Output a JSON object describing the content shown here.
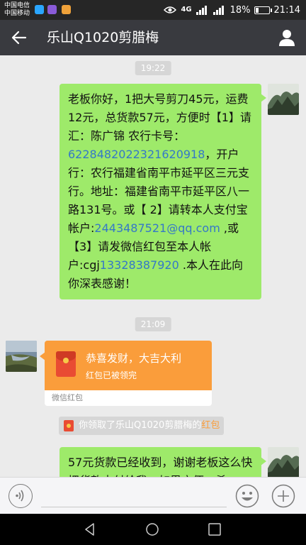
{
  "status_bar": {
    "carrier1": "中国电信",
    "carrier2": "中国移动",
    "network": "4G",
    "battery": "18%",
    "time": "21:14"
  },
  "header": {
    "title": "乐山Q1020剪腊梅",
    "back_icon": "arrow-left-icon",
    "profile_icon": "person-icon"
  },
  "messages": {
    "time1": "19:22",
    "msg1": {
      "part1": "老板你好，1把大号剪刀45元，运费12元，总货款57元，方便时【1】请汇：陈广锦 农行卡号：",
      "card": "6228482022321620918",
      "part2": "，开户行：农行福建省南平市延平区三元支行。地址：福建省南平市延平区八一路131号。或【 2】请转本人支付宝帐户:",
      "email": "2443487521@qq.com",
      "part3": " ,或【3】请发微信红包至本人帐户:cgj",
      "phone": "13328387920",
      "part4": " .本人在此向你深表感谢！"
    },
    "time2": "21:09",
    "red_packet": {
      "title": "恭喜发财，大吉大利",
      "status": "红包已被领完",
      "footer": "微信红包"
    },
    "notice": {
      "text": "你领取了乐山Q1020剪腊梅的",
      "highlight": "红包"
    },
    "msg2": "57元货款已经收到，谢谢老板这么快把货款支付给我，如果方便，希"
  },
  "input_bar": {
    "voice_icon": "voice-icon",
    "emoji_icon": "emoji-icon",
    "plus_icon": "plus-icon"
  },
  "colors": {
    "header_bg": "#393a3f",
    "bubble_green": "#9eea6a",
    "red_packet_orange": "#fa9d3b",
    "chat_bg": "#ebebeb"
  }
}
